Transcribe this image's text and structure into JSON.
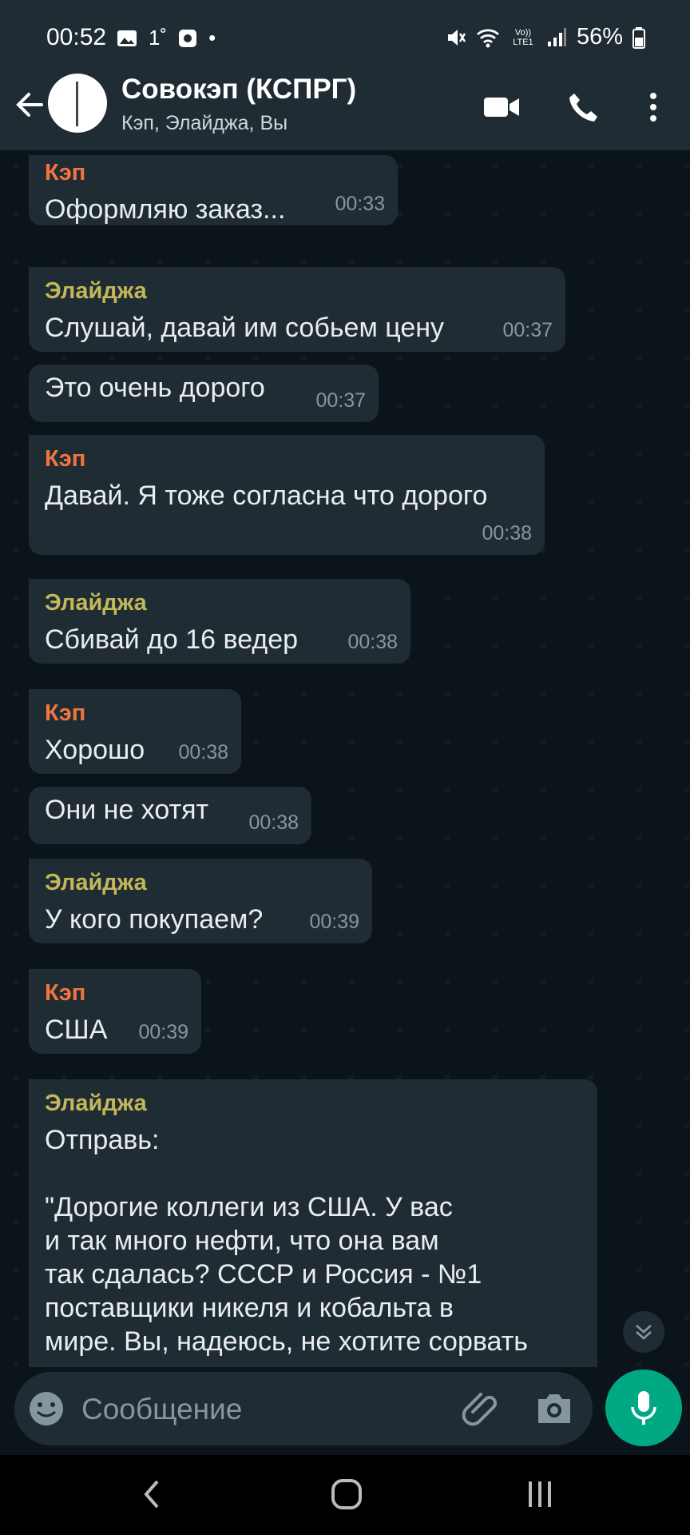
{
  "status_bar": {
    "time": "00:52",
    "temp": "1˚",
    "volte": "Vo)) LTE1",
    "battery": "56%"
  },
  "header": {
    "title": "Совокэп (КСПРГ)",
    "subtitle": "Кэп, Элайджа, Вы",
    "icons": [
      "back-arrow-icon",
      "video-call-icon",
      "phone-icon",
      "more-vert-icon"
    ]
  },
  "messages": [
    {
      "sender": "Кэп",
      "text": "Оформляю заказ...",
      "time": "00:33"
    },
    {
      "sender": "Элайджа",
      "text": "Слушай, давай им собьем цену",
      "time": "00:37"
    },
    {
      "sender": "",
      "text": "Это очень дорого",
      "time": "00:37"
    },
    {
      "sender": "Кэп",
      "text": "Давай. Я тоже согласна что дорого",
      "time": "00:38"
    },
    {
      "sender": "Элайджа",
      "text": "Сбивай до 16 ведер",
      "time": "00:38"
    },
    {
      "sender": "Кэп",
      "text": "Хорошо",
      "time": "00:38"
    },
    {
      "sender": "",
      "text": "Они не хотят",
      "time": "00:38"
    },
    {
      "sender": "Элайджа",
      "text": "У кого покупаем?",
      "time": "00:39"
    },
    {
      "sender": "Кэп",
      "text": "США",
      "time": "00:39"
    },
    {
      "sender": "Элайджа",
      "text": "Отправь:\n\n\"Дорогие коллеги из США. У вас\nи так много нефти, что она вам\nтак сдалась? СССР и Россия - №1\nпоставщики никеля и кобальта в\nмире. Вы, надеюсь, не хотите сорвать",
      "time": ""
    }
  ],
  "input": {
    "placeholder": "Сообщение"
  },
  "colors": {
    "accent": "#00a884",
    "kep": "#f0753f",
    "elijah": "#c2b75a",
    "bubble": "#202c33",
    "background": "#0b141a"
  }
}
